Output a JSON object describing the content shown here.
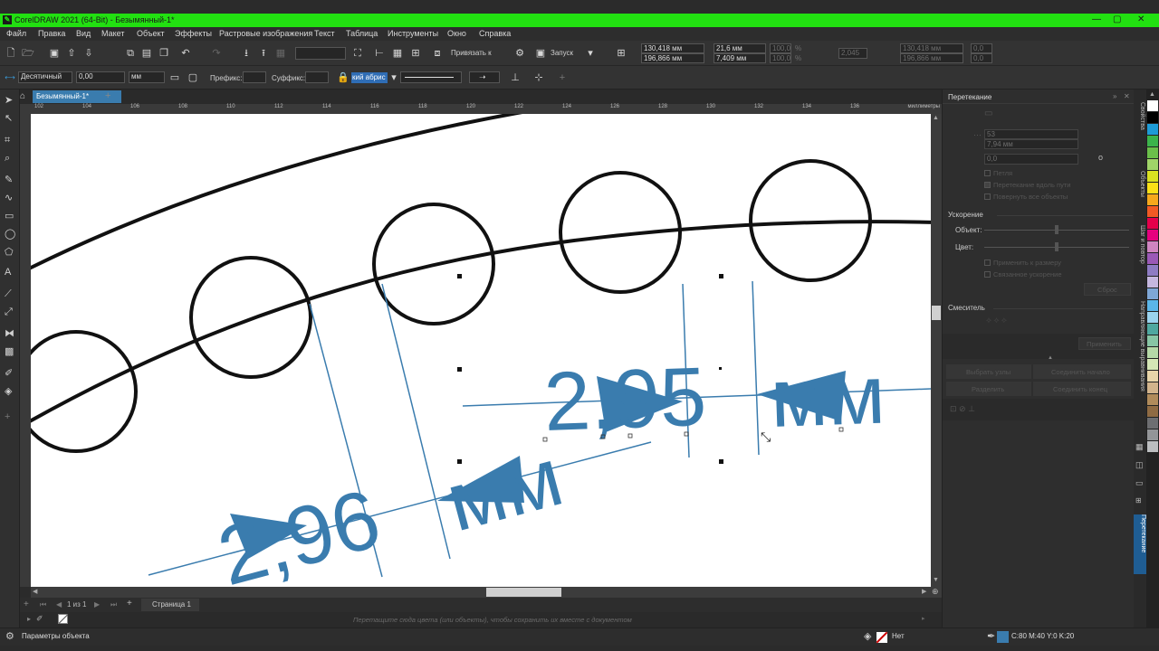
{
  "window": {
    "title": "CorelDRAW 2021 (64-Bit) - Безымянный-1*",
    "controls": [
      "—",
      "▢",
      "✕"
    ]
  },
  "menu": [
    "Файл",
    "Правка",
    "Вид",
    "Макет",
    "Объект",
    "Эффекты",
    "Растровые изображения",
    "Текст",
    "Таблица",
    "Инструменты",
    "Окно",
    "Справка"
  ],
  "toolbar1": {
    "snap_label": "Привязать к",
    "launch_label": "Запуск",
    "pos_x": "130,418 мм",
    "pos_y": "196,866 мм",
    "size_w": "21,6 мм",
    "size_h": "7,409 мм",
    "scale_w": "100,0",
    "scale_h": "100,0",
    "unit_pct": "%",
    "angle": "2,045",
    "pos2_x": "130,418 мм",
    "pos2_y": "196,866 мм",
    "rot_a": "0,0",
    "rot_b": "0,0"
  },
  "toolbar2": {
    "style": "Десятичный",
    "precision": "0,00",
    "units": "мм",
    "prefix_label": "Префикс:",
    "suffix_label": "Суффикс:",
    "outline_value": "кий абрис"
  },
  "doc_tab": {
    "label": "Безымянный-1*",
    "add": "+"
  },
  "ruler": {
    "h_ticks": [
      "102",
      "104",
      "106",
      "108",
      "110",
      "112",
      "114",
      "116",
      "118",
      "120",
      "122",
      "124",
      "126",
      "128",
      "130",
      "132",
      "134",
      "136"
    ],
    "unit": "миллиметры"
  },
  "canvas": {
    "dim1_number": "2,95",
    "dim1_unit": "мм",
    "dim2_number": "2,96",
    "dim2_unit": "мм",
    "accent": "#3a7cae"
  },
  "pagebar": {
    "page_of": "1  из  1",
    "page_tab": "Страница 1"
  },
  "color_hint": "Перетащите сюда цвета (или объекты), чтобы сохранить их вместе с документом",
  "docker": {
    "title": "Перетекание",
    "steps": "53",
    "spacing": "7,94 мм",
    "angle": "0,0",
    "checks": [
      "Петля",
      "Перетекание вдоль пути",
      "Повернуть все объекты"
    ],
    "accel_title": "Ускорение",
    "accel_object": "Объект:",
    "accel_color": "Цвет:",
    "accel_checks": [
      "Применить к размеру",
      "Связанное ускорение"
    ],
    "reset": "Сброс",
    "mixer_title": "Смеситель",
    "apply": "Применить",
    "select_nodes": "Выбрать узлы",
    "join_start": "Соединить начало",
    "split": "Разделить",
    "join_end": "Соединить конец"
  },
  "docker_tabs": [
    "Свойства",
    "Объекты",
    "Шаг и повтор",
    "Направляющие выравнивания",
    "Перетекание"
  ],
  "palette_colors": [
    "#ffffff",
    "#000000",
    "#1e9bd7",
    "#3cb44b",
    "#6bbf4a",
    "#a0d468",
    "#d9e021",
    "#fbe017",
    "#f6a81c",
    "#f15a24",
    "#e5004b",
    "#e6007e",
    "#cf85c0",
    "#9b59b6",
    "#8e7cc3",
    "#c5b7df",
    "#7fa7d6",
    "#5bb5e8",
    "#9bd3ee",
    "#4fa8a0",
    "#88c6a5",
    "#b5d8a7",
    "#d4e6b5",
    "#e8d5a9",
    "#d2b48c",
    "#b08b5b",
    "#8f6b43",
    "#6d6e71",
    "#939598",
    "#bcbec0"
  ],
  "status": {
    "object_params": "Параметры объекта",
    "fill_none": "Нет",
    "outline_color": "C:80 M:40 Y:0 K:20",
    "outline_swatch": "#3a7cae"
  }
}
